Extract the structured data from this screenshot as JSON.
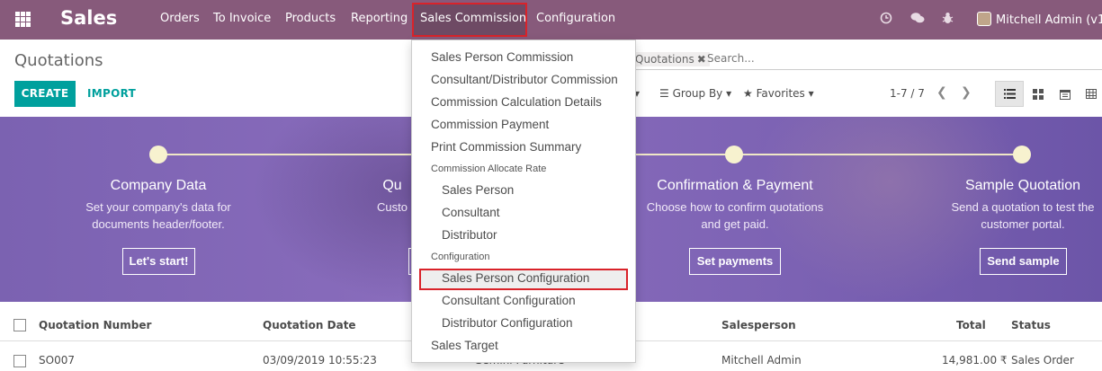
{
  "navbar": {
    "brand": "Sales",
    "menu": [
      "Orders",
      "To Invoice",
      "Products",
      "Reporting",
      "Sales Commission",
      "Configuration"
    ],
    "user": "Mitchell Admin (v12"
  },
  "breadcrumb": "Quotations",
  "buttons": {
    "create": "CREATE",
    "import": "IMPORT"
  },
  "search": {
    "facet": "Quotations",
    "placeholder": "Search..."
  },
  "filters": {
    "group_by": "Group By",
    "favorites": "Favorites"
  },
  "pager": "1-7 / 7",
  "onboarding": [
    {
      "title": "Company Data",
      "desc1": "Set your company's data for",
      "desc2": "documents header/footer.",
      "button": "Let's start!"
    },
    {
      "title": "Qu",
      "desc1": "Custo",
      "desc2": "",
      "button": ""
    },
    {
      "title": "Confirmation & Payment",
      "desc1": "Choose how to confirm quotations",
      "desc2": "and get paid.",
      "button": "Set payments"
    },
    {
      "title": "Sample Quotation",
      "desc1": "Send a quotation to test the",
      "desc2": "customer portal.",
      "button": "Send sample"
    }
  ],
  "list": {
    "columns": [
      "Quotation Number",
      "Quotation Date",
      "Salesperson",
      "Total",
      "Status"
    ],
    "rows": [
      {
        "number": "SO007",
        "date": "03/09/2019 10:55:23",
        "customer": "Gemini Furniture",
        "salesperson": "Mitchell Admin",
        "total": "14,981.00 ₹",
        "status": "Sales Order"
      }
    ]
  },
  "dropdown": {
    "items": [
      "Sales Person Commission",
      "Consultant/Distributor Commission",
      "Commission Calculation Details",
      "Commission Payment",
      "Print Commission Summary"
    ],
    "header_rate": "Commission Allocate Rate",
    "rate_items": [
      "Sales Person",
      "Consultant",
      "Distributor"
    ],
    "header_config": "Configuration",
    "config_items": [
      "Sales Person Configuration",
      "Consultant Configuration",
      "Distributor Configuration"
    ],
    "last_item": "Sales Target"
  },
  "colors": {
    "navbar": "#875a7b",
    "accent": "#00a09d",
    "highlight": "#d9232a"
  }
}
